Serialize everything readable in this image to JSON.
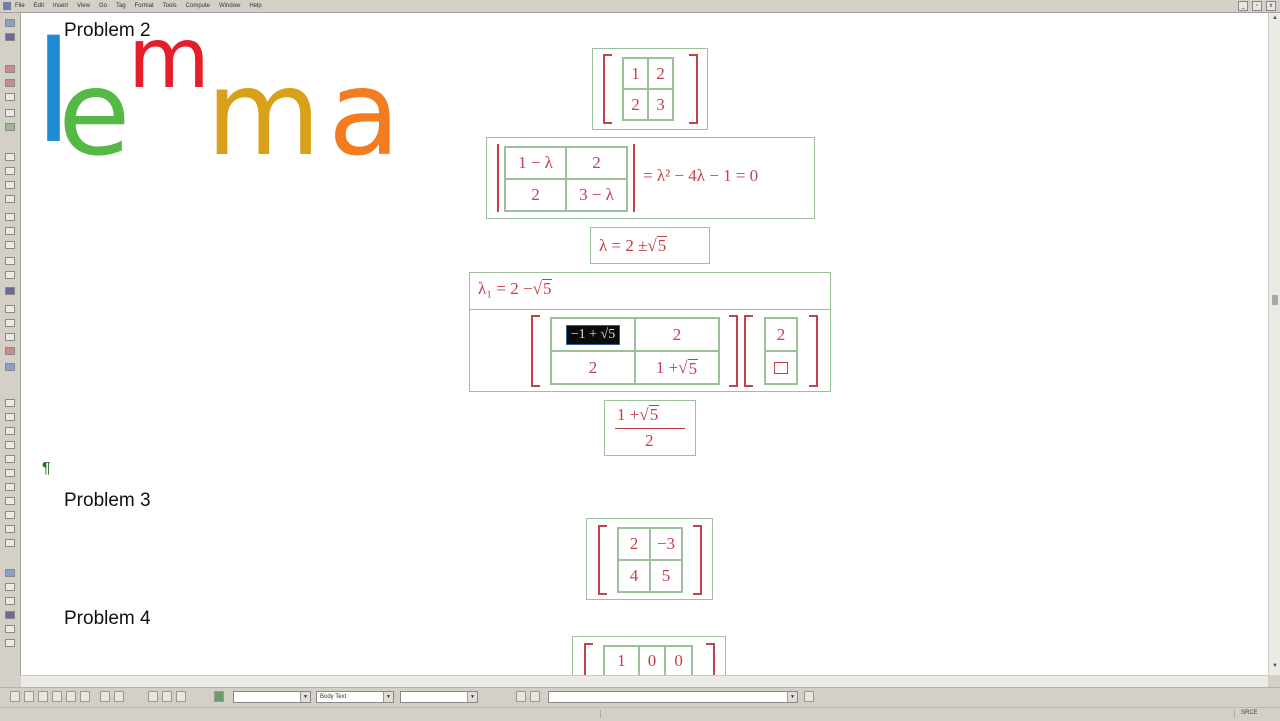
{
  "menubar": {
    "items": [
      "File",
      "Edit",
      "Insert",
      "View",
      "Go",
      "Tag",
      "Format",
      "Tools",
      "Compute",
      "Window",
      "Help"
    ]
  },
  "window_controls": {
    "minimize": "_",
    "restore": "▫",
    "close": "x"
  },
  "headings": {
    "p2": "Problem 2",
    "p3": "Problem 3",
    "p4": "Problem 4"
  },
  "logo": {
    "l": "l",
    "e": "e",
    "m1": "m",
    "m2": "m",
    "a": "a",
    "colors": {
      "l": "#1f8bd3",
      "e": "#56b947",
      "m1": "#e61e2b",
      "m2": "#d9a01a",
      "a": "#f47c20"
    }
  },
  "problem2": {
    "matrix": [
      [
        "1",
        "2"
      ],
      [
        "2",
        "3"
      ]
    ],
    "det_matrix": [
      [
        "1 − λ",
        "2"
      ],
      [
        "2",
        "3 − λ"
      ]
    ],
    "char_eq": "= λ² − 4λ − 1 = 0",
    "eigen_lhs": "λ = 2 ±",
    "eigen_rad": "5",
    "lambda1_lhs": "λ₁ = 2 −",
    "lambda1_rad": "5",
    "sys_cell00": "−1 + √5",
    "sys_cell01": "2",
    "sys_cell10": "2",
    "sys_cell11_lhs": "1 +",
    "sys_cell11_rad": "5",
    "vector_top": "2",
    "frac_num_lhs": "1 +",
    "frac_num_rad": "5",
    "frac_den": "2"
  },
  "problem3": {
    "matrix": [
      [
        "2",
        "−3"
      ],
      [
        "4",
        "5"
      ]
    ]
  },
  "problem4": {
    "matrix_row0": [
      "1",
      "0",
      "0"
    ]
  },
  "pilcrow": "¶",
  "statusbar": {
    "style": "Body Text"
  },
  "bottom": {
    "caps": "SRCE"
  }
}
